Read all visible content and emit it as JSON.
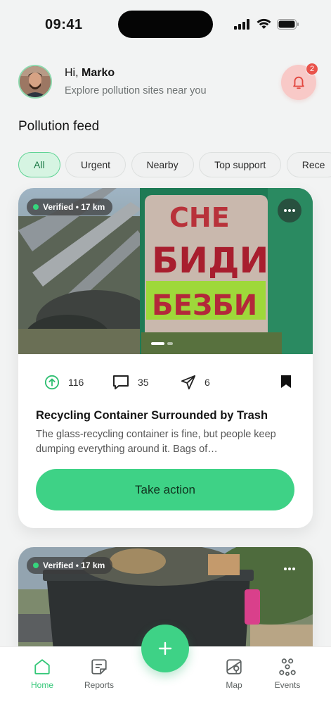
{
  "status_bar": {
    "time": "09:41"
  },
  "header": {
    "greeting_prefix": "Hi, ",
    "user_name": "Marko",
    "subtitle": "Explore pollution sites near you",
    "notification_count": "2"
  },
  "feed": {
    "title": "Pollution feed",
    "filters": [
      "All",
      "Urgent",
      "Nearby",
      "Top support",
      "Rece"
    ],
    "active_filter": "All"
  },
  "posts": [
    {
      "badge": "Verified • 17 km",
      "upvotes": "116",
      "comments": "35",
      "shares": "6",
      "title": "Recycling Container Surrounded by Trash",
      "description": "The glass-recycling container is fine, but people keep dumping everything around it. Bags of…",
      "cta_label": "Take action",
      "photo_graffiti_line1": "СНЕ",
      "photo_graffiti_line2": "БИДИ",
      "photo_graffiti_line3": "БЕЗБИ"
    },
    {
      "badge": "Verified • 17 km"
    }
  ],
  "tabbar": {
    "items": [
      {
        "label": "Home",
        "icon": "home-icon"
      },
      {
        "label": "Reports",
        "icon": "reports-icon"
      },
      {
        "label": "Map",
        "icon": "map-icon"
      },
      {
        "label": "Events",
        "icon": "events-icon"
      }
    ],
    "fab_icon": "plus-icon"
  },
  "colors": {
    "accent": "#3ed286",
    "badge": "#e9534b",
    "chip_active_bg": "#d6f4e2"
  }
}
